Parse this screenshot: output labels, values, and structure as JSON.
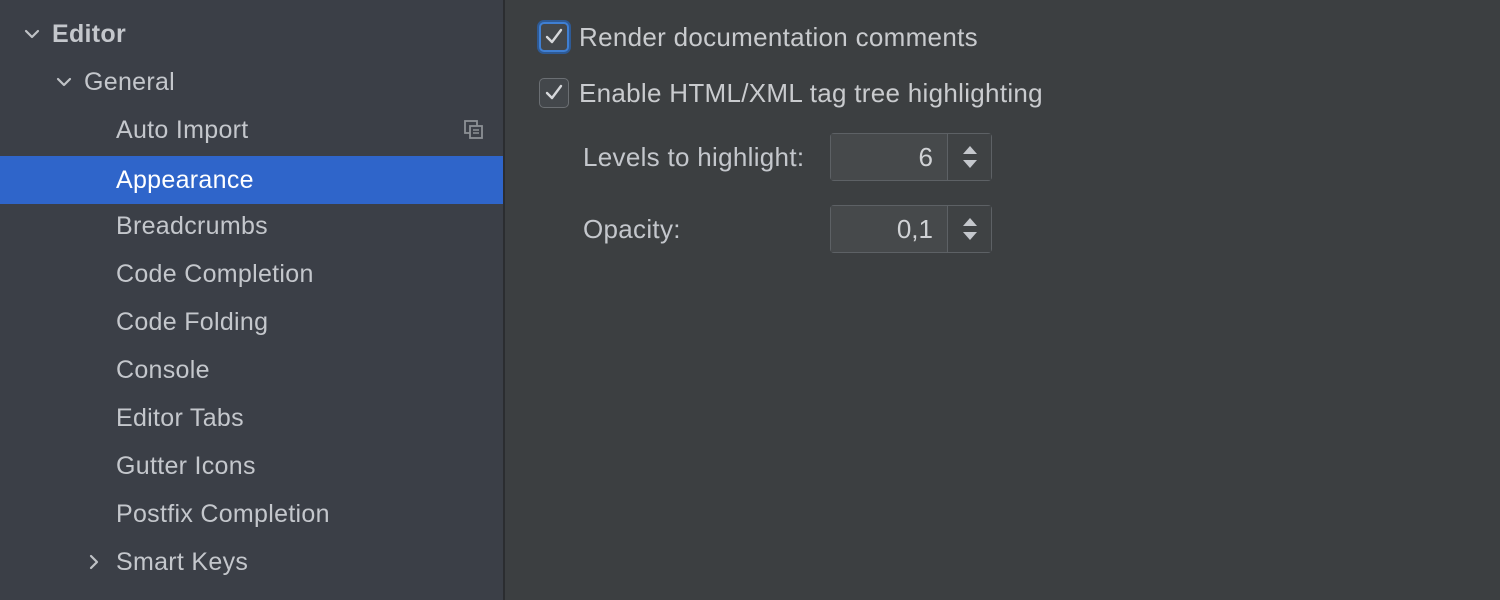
{
  "sidebar": {
    "partial_top_label": "... ..",
    "items": [
      {
        "label": "Editor",
        "level": 0,
        "expanded": true,
        "bold": true
      },
      {
        "label": "General",
        "level": 1,
        "expanded": true
      },
      {
        "label": "Auto Import",
        "level": 2,
        "has_copy_icon": true
      },
      {
        "label": "Appearance",
        "level": 2,
        "selected": true
      },
      {
        "label": "Breadcrumbs",
        "level": 2
      },
      {
        "label": "Code Completion",
        "level": 2
      },
      {
        "label": "Code Folding",
        "level": 2
      },
      {
        "label": "Console",
        "level": 2
      },
      {
        "label": "Editor Tabs",
        "level": 2
      },
      {
        "label": "Gutter Icons",
        "level": 2
      },
      {
        "label": "Postfix Completion",
        "level": 2
      },
      {
        "label": "Smart Keys",
        "level": 2,
        "collapsed": true
      }
    ]
  },
  "main": {
    "render_doc_comments": {
      "label": "Render documentation comments",
      "checked": true
    },
    "tag_tree_highlighting": {
      "label": "Enable HTML/XML tag tree highlighting",
      "checked": true
    },
    "levels": {
      "label": "Levels to highlight:",
      "value": "6"
    },
    "opacity": {
      "label": "Opacity:",
      "value": "0,1"
    }
  },
  "colors": {
    "sidebar_bg": "#3b3f47",
    "selection": "#2f65ca",
    "panel_bg": "#3c3f41",
    "text": "#c4c7cc"
  },
  "icons": {
    "expand": "chevron-down-icon",
    "collapsed": "chevron-right-icon",
    "copy": "copy-icon",
    "check": "checkmark-icon",
    "spinner": "spinner-arrows-icon"
  }
}
